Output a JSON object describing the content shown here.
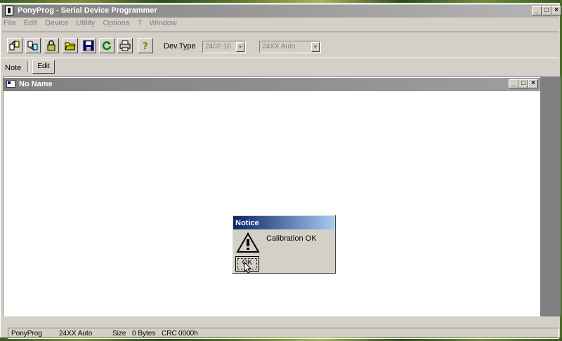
{
  "window": {
    "title": "PonyProg - Serial Device Programmer",
    "min_label": "_",
    "max_label": "□",
    "close_label": "×"
  },
  "menu": {
    "items": [
      "File",
      "Edit",
      "Device",
      "Utility",
      "Options",
      "?",
      "Window"
    ]
  },
  "toolbar": {
    "icons": [
      "read-all-icon",
      "write-all-icon",
      "lock-icon",
      "open-icon",
      "save-icon",
      "reload-icon",
      "print-icon",
      "help-icon"
    ],
    "devtype_label": "Dev.Type",
    "device_value": "2402-16",
    "subtype_value": "24XX Auto"
  },
  "note": {
    "label": "Note",
    "edit_button": "Edit"
  },
  "child_window": {
    "title": "No Name"
  },
  "dialog": {
    "title": "Notice",
    "message": "Calibration OK",
    "ok_label": "OK"
  },
  "status": {
    "app": "PonyProg",
    "device": "24XX Auto",
    "size_label": "Size",
    "size_value": "0 Bytes",
    "crc_label": "CRC",
    "crc_value": "0000h"
  },
  "colors": {
    "dialog_title": "#0a246a",
    "inactive_title": "#808080",
    "face": "#d4d0c8"
  }
}
